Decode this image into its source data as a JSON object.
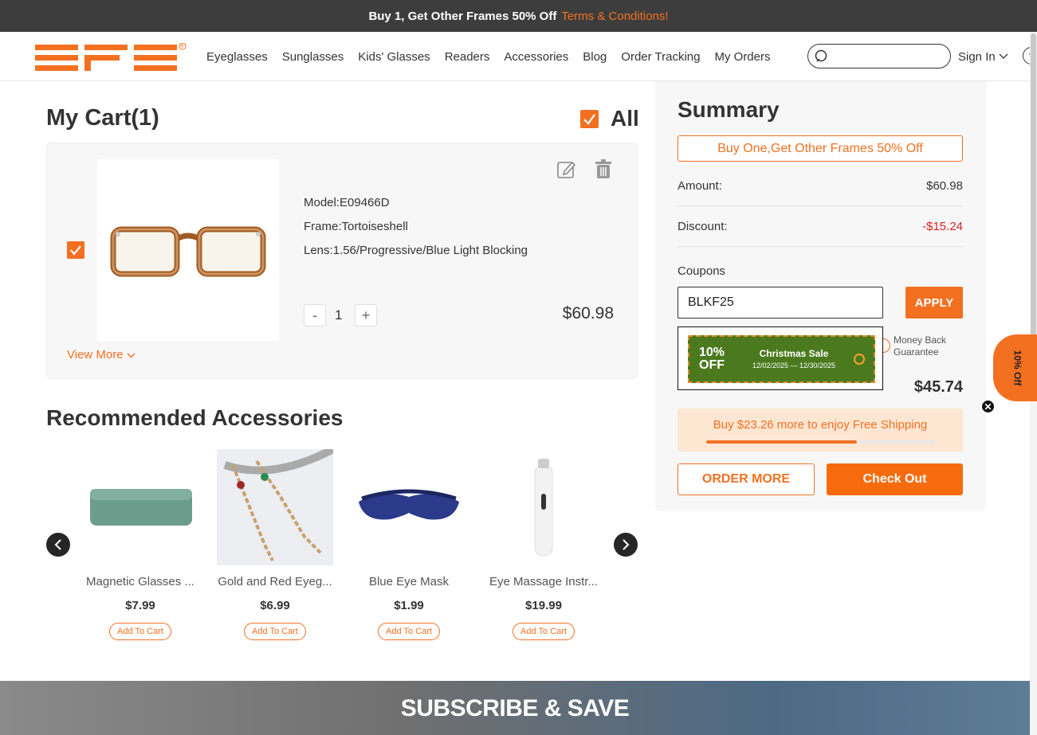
{
  "promo_bar": {
    "text": "Buy 1, Get Other Frames 50% Off",
    "link": "Terms & Conditions!"
  },
  "header": {
    "logo": "EFE",
    "nav": [
      "Eyeglasses",
      "Sunglasses",
      "Kids' Glasses",
      "Readers",
      "Accessories",
      "Blog",
      "Order Tracking",
      "My Orders"
    ],
    "search_placeholder": "",
    "sign_in": "Sign In",
    "help": "?"
  },
  "cart": {
    "title": "My Cart(1)",
    "all_label": "All",
    "item": {
      "model": "Model:E09466D",
      "frame": "Frame:Tortoiseshell",
      "lens": "Lens:1.56/Progressive/Blue Light Blocking",
      "qty_minus": "-",
      "qty": "1",
      "qty_plus": "+",
      "price": "$60.98"
    },
    "view_more": "View More"
  },
  "recommended": {
    "title": "Recommended Accessories",
    "products": [
      {
        "name": "Magnetic Glasses ...",
        "price": "$7.99",
        "button": "Add To Cart"
      },
      {
        "name": "Gold and Red Eyeg...",
        "price": "$6.99",
        "button": "Add To Cart"
      },
      {
        "name": "Blue Eye Mask",
        "price": "$1.99",
        "button": "Add To Cart"
      },
      {
        "name": "Eye Massage Instr...",
        "price": "$19.99",
        "button": "Add To Cart"
      }
    ]
  },
  "subscribe": {
    "title": "SUBSCRIBE & SAVE"
  },
  "summary": {
    "title": "Summary",
    "promo_button": "Buy One,Get Other Frames 50% Off",
    "amount_label": "Amount:",
    "amount_value": "$60.98",
    "discount_label": "Discount:",
    "discount_value": "-$15.24",
    "coupons_label": "Coupons",
    "coupon_value": "BLKF25",
    "apply": "APPLY",
    "coupon_popup": {
      "percent_line1": "10%",
      "percent_line2": "OFF",
      "name": "Christmas Sale",
      "dates": "12/02/2025 — 12/30/2025"
    },
    "money_back": "Money Back Guarantee",
    "total_value": "$45.74",
    "shipping_text": "Buy $23.26 more to enjoy Free Shipping",
    "shipping_progress": 0.66,
    "order_more": "ORDER MORE",
    "checkout": "Check Out"
  },
  "side_tab": {
    "label": "10% Off"
  },
  "colors": {
    "accent": "#f37021",
    "discount_red": "#e02020",
    "promo_bar_bg": "#3d3d3d",
    "coupon_green": "#4b7a1e"
  }
}
